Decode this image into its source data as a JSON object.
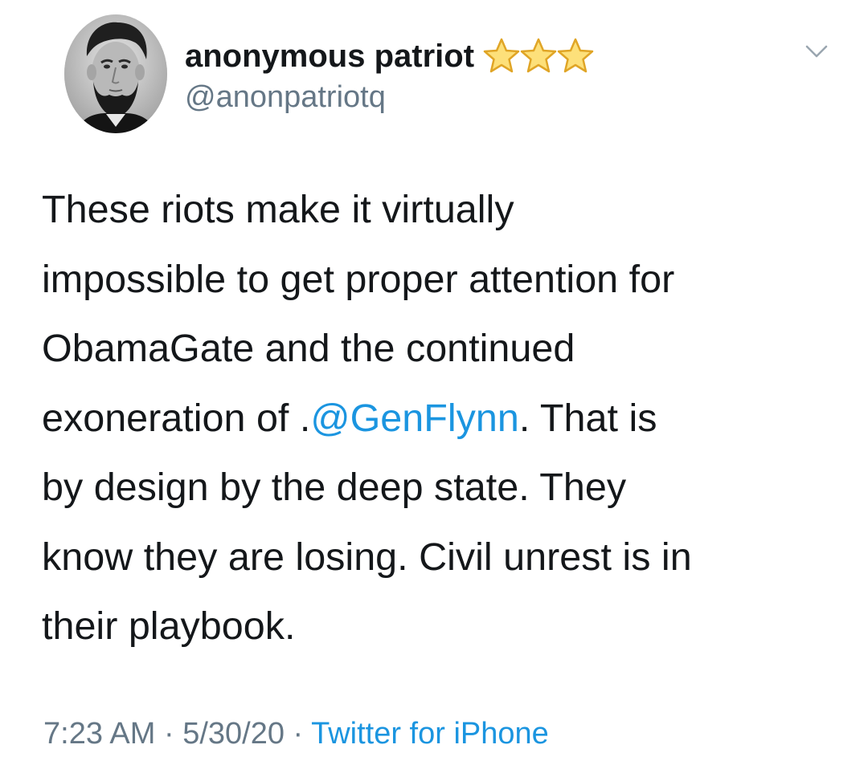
{
  "tweet": {
    "author": {
      "display_name": "anonymous patriot",
      "handle": "@anonpatriotq",
      "badge_icons": [
        "star-icon",
        "star-icon",
        "star-icon"
      ]
    },
    "menu_icon": "chevron-down-icon",
    "text": {
      "line1": "These riots make it virtually",
      "line2": "impossible to get proper attention for",
      "line3": "ObamaGate and the continued",
      "line4_before": "exoneration of .",
      "line4_mention": "@GenFlynn",
      "line4_after": ". That is",
      "line5": "by design by the deep state. They",
      "line6": "know they are losing. Civil unrest is in",
      "line7": "their playbook."
    },
    "meta": {
      "time": "7:23 AM",
      "sep1": " · ",
      "date": "5/30/20",
      "sep2": " · ",
      "source": "Twitter for iPhone"
    }
  },
  "colors": {
    "text": "#14171a",
    "secondary": "#657786",
    "link": "#1b95e0",
    "star_fill": "#fde07a",
    "star_stroke": "#e0a526"
  }
}
